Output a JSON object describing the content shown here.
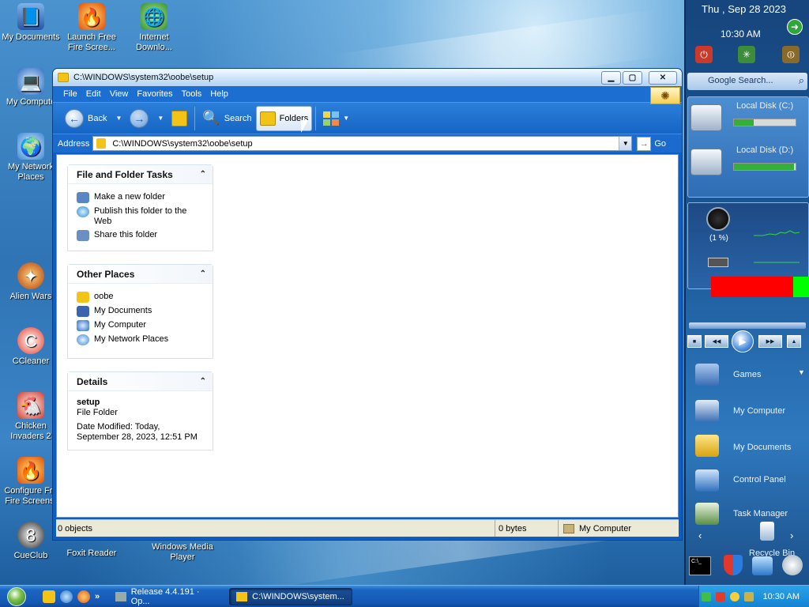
{
  "desktop": {
    "icons": [
      {
        "label": "My Documents"
      },
      {
        "label": "Launch Free Fire Scree..."
      },
      {
        "label": "Internet Downlo..."
      },
      {
        "label": "My Compute"
      },
      {
        "label": "My Network Places"
      },
      {
        "label": "Alien Wars"
      },
      {
        "label": "CCleaner"
      },
      {
        "label": "Chicken Invaders 2"
      },
      {
        "label": "Configure Fre Fire Screens."
      },
      {
        "label": "CueClub"
      },
      {
        "label": "Foxit Reader"
      },
      {
        "label": "Windows Media Player"
      }
    ]
  },
  "window": {
    "title": "C:\\WINDOWS\\system32\\oobe\\setup",
    "menu": [
      "File",
      "Edit",
      "View",
      "Favorites",
      "Tools",
      "Help"
    ],
    "toolbar": {
      "back": "Back",
      "search": "Search",
      "folders": "Folders"
    },
    "address": {
      "label": "Address",
      "value": "C:\\WINDOWS\\system32\\oobe\\setup",
      "go": "Go"
    },
    "tasks": {
      "title": "File and Folder Tasks",
      "items": [
        "Make a new folder",
        "Publish this folder to the Web",
        "Share this folder"
      ]
    },
    "places": {
      "title": "Other Places",
      "items": [
        "oobe",
        "My Documents",
        "My Computer",
        "My Network Places"
      ]
    },
    "details": {
      "title": "Details",
      "name": "setup",
      "type": "File Folder",
      "modified": "Date Modified: Today, September 28, 2023, 12:51 PM"
    },
    "status": {
      "objects": "0 objects",
      "size": "0 bytes",
      "location": "My Computer"
    }
  },
  "sidebar": {
    "date": "Thu , Sep 28 2023",
    "time": "10:30 AM",
    "search_placeholder": "Google Search...",
    "disks": [
      {
        "label": "Local Disk (C:)",
        "usage": 0.32
      },
      {
        "label": "Local Disk (D:)",
        "usage": 0.97
      }
    ],
    "cpu": "(1 %)",
    "launch": [
      "Games",
      "My Computer",
      "My Documents",
      "Control Panel",
      "Task Manager",
      "Recycle Bin"
    ]
  },
  "taskbar": {
    "tasks": [
      "Release 4.4.191 · Op...",
      "C:\\WINDOWS\\system..."
    ],
    "clock": "10:30 AM"
  },
  "colors": {
    "accent": "#1c6fd0",
    "ram_bar": "#ff0000",
    "ram_free": "#00ff00"
  }
}
